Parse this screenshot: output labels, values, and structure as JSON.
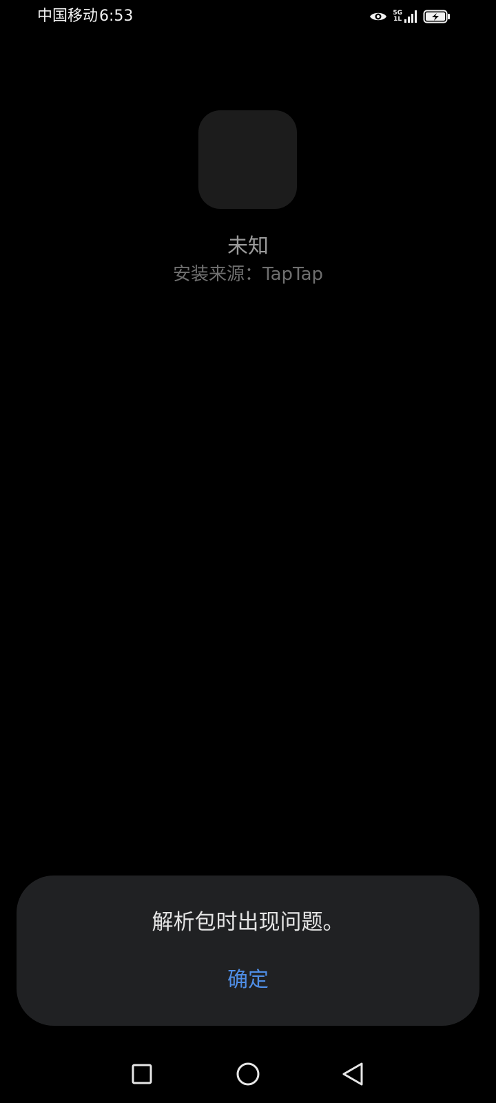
{
  "status_bar": {
    "carrier": "中国移动",
    "time": "6:53",
    "network_type": "5G",
    "network_sub": "1L",
    "icons": [
      "eye-icon",
      "signal-icon",
      "battery-charging-icon"
    ]
  },
  "app": {
    "name": "未知",
    "install_source": "安装来源：TapTap"
  },
  "dialog": {
    "message": "解析包时出现问题。",
    "confirm_label": "确定",
    "accent_color": "#4f8ee6"
  },
  "nav_bar": {
    "icons": [
      "recents-square-icon",
      "home-circle-icon",
      "back-triangle-icon"
    ]
  }
}
